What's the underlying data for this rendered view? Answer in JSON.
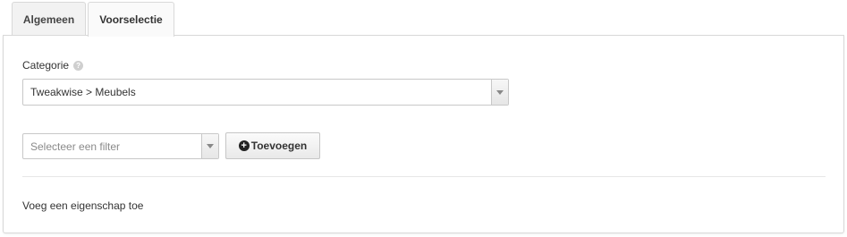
{
  "tabs": [
    {
      "label": "Algemeen",
      "active": false
    },
    {
      "label": "Voorselectie",
      "active": true
    }
  ],
  "category": {
    "label": "Categorie",
    "help_icon": "question-icon",
    "value": "Tweakwise > Meubels"
  },
  "filter": {
    "placeholder": "Selecteer een filter"
  },
  "add_button": {
    "label": "Toevoegen",
    "icon": "plus-circle-icon"
  },
  "property_note": "Voeg een eigenschap toe"
}
